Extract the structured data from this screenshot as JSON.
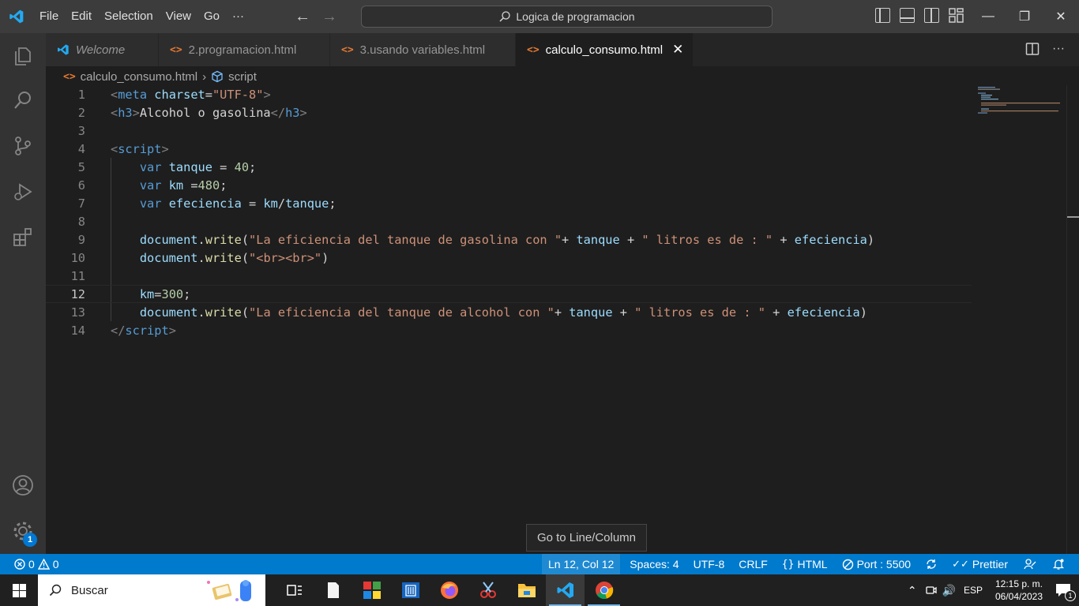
{
  "titlebar": {
    "menu": [
      "File",
      "Edit",
      "Selection",
      "View",
      "Go",
      "···"
    ],
    "search": "Logica de programacion"
  },
  "tabs": [
    {
      "label": "Welcome",
      "active": false,
      "italic": true
    },
    {
      "label": "2.programacion.html",
      "active": false
    },
    {
      "label": "3.usando variables.html",
      "active": false
    },
    {
      "label": "calculo_consumo.html",
      "active": true
    }
  ],
  "breadcrumb": {
    "file": "calculo_consumo.html",
    "symbol": "script"
  },
  "editor": {
    "current_line": 12,
    "line_numbers": [
      "1",
      "2",
      "3",
      "4",
      "5",
      "6",
      "7",
      "8",
      "9",
      "10",
      "11",
      "12",
      "13",
      "14"
    ],
    "lines": [
      [
        [
          "t-punc",
          "<"
        ],
        [
          "t-tag",
          "meta"
        ],
        [
          "t-txt",
          " "
        ],
        [
          "t-attr",
          "charset"
        ],
        [
          "t-txt",
          "="
        ],
        [
          "t-str",
          "\"UTF-8\""
        ],
        [
          "t-punc",
          ">"
        ]
      ],
      [
        [
          "t-punc",
          "<"
        ],
        [
          "t-tag",
          "h3"
        ],
        [
          "t-punc",
          ">"
        ],
        [
          "t-txt",
          "Alcohol o gasolina"
        ],
        [
          "t-punc",
          "</"
        ],
        [
          "t-tag",
          "h3"
        ],
        [
          "t-punc",
          ">"
        ]
      ],
      [],
      [
        [
          "t-punc",
          "<"
        ],
        [
          "t-tag",
          "script"
        ],
        [
          "t-punc",
          ">"
        ]
      ],
      [
        [
          "t-txt",
          "    "
        ],
        [
          "t-kw",
          "var"
        ],
        [
          "t-txt",
          " "
        ],
        [
          "t-var",
          "tanque"
        ],
        [
          "t-txt",
          " = "
        ],
        [
          "t-num",
          "40"
        ],
        [
          "t-txt",
          ";"
        ]
      ],
      [
        [
          "t-txt",
          "    "
        ],
        [
          "t-kw",
          "var"
        ],
        [
          "t-txt",
          " "
        ],
        [
          "t-var",
          "km"
        ],
        [
          "t-txt",
          " ="
        ],
        [
          "t-num",
          "480"
        ],
        [
          "t-txt",
          ";"
        ]
      ],
      [
        [
          "t-txt",
          "    "
        ],
        [
          "t-kw",
          "var"
        ],
        [
          "t-txt",
          " "
        ],
        [
          "t-var",
          "efeciencia"
        ],
        [
          "t-txt",
          " = "
        ],
        [
          "t-var",
          "km"
        ],
        [
          "t-txt",
          "/"
        ],
        [
          "t-var",
          "tanque"
        ],
        [
          "t-txt",
          ";"
        ]
      ],
      [],
      [
        [
          "t-txt",
          "    "
        ],
        [
          "t-var",
          "document"
        ],
        [
          "t-txt",
          "."
        ],
        [
          "t-fn",
          "write"
        ],
        [
          "t-txt",
          "("
        ],
        [
          "t-str",
          "\"La eficiencia del tanque de gasolina con \""
        ],
        [
          "t-txt",
          "+ "
        ],
        [
          "t-var",
          "tanque"
        ],
        [
          "t-txt",
          " + "
        ],
        [
          "t-str",
          "\" litros es de : \""
        ],
        [
          "t-txt",
          " + "
        ],
        [
          "t-var",
          "efeciencia"
        ],
        [
          "t-txt",
          ")"
        ]
      ],
      [
        [
          "t-txt",
          "    "
        ],
        [
          "t-var",
          "document"
        ],
        [
          "t-txt",
          "."
        ],
        [
          "t-fn",
          "write"
        ],
        [
          "t-txt",
          "("
        ],
        [
          "t-str",
          "\"<br><br>\""
        ],
        [
          "t-txt",
          ")"
        ]
      ],
      [],
      [
        [
          "t-txt",
          "    "
        ],
        [
          "t-var",
          "km"
        ],
        [
          "t-txt",
          "="
        ],
        [
          "t-num",
          "300"
        ],
        [
          "t-txt",
          ";"
        ]
      ],
      [
        [
          "t-txt",
          "    "
        ],
        [
          "t-var",
          "document"
        ],
        [
          "t-txt",
          "."
        ],
        [
          "t-fn",
          "write"
        ],
        [
          "t-txt",
          "("
        ],
        [
          "t-str",
          "\"La eficiencia del tanque de alcohol con \""
        ],
        [
          "t-txt",
          "+ "
        ],
        [
          "t-var",
          "tanque"
        ],
        [
          "t-txt",
          " + "
        ],
        [
          "t-str",
          "\" litros es de : \""
        ],
        [
          "t-txt",
          " + "
        ],
        [
          "t-var",
          "efeciencia"
        ],
        [
          "t-txt",
          ")"
        ]
      ],
      [
        [
          "t-punc",
          "</"
        ],
        [
          "t-tag",
          "script"
        ],
        [
          "t-punc",
          ">"
        ]
      ]
    ]
  },
  "tooltip": "Go to Line/Column",
  "statusbar": {
    "errors": "0",
    "warnings": "0",
    "position": "Ln 12, Col 12",
    "spaces": "Spaces: 4",
    "encoding": "UTF-8",
    "eol": "CRLF",
    "language": "HTML",
    "port": "Port : 5500",
    "prettier": "Prettier"
  },
  "activity": {
    "settings_badge": "1"
  },
  "taskbar": {
    "search_placeholder": "Buscar",
    "lang": "ESP",
    "time": "12:15 p. m.",
    "date": "06/04/2023",
    "notifications": "1"
  },
  "colors": {
    "accent": "#007acc",
    "file_icon": "#e37933"
  }
}
